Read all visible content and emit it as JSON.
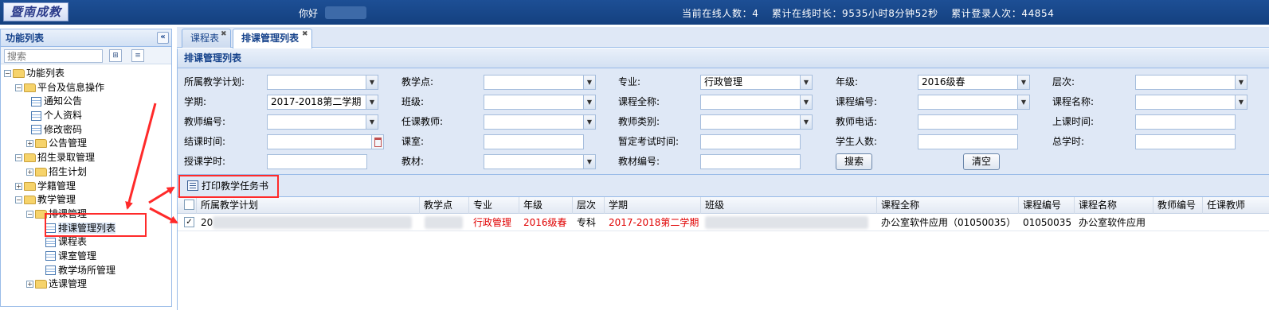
{
  "topbar": {
    "logo_text": "暨南成教",
    "greeting": "你好",
    "online_count_label": "当前在线人数：4",
    "online_time_label": "累计在线时长：9535小时8分钟52秒",
    "login_count_label": "累计登录人次：44854"
  },
  "left_panel": {
    "title": "功能列表",
    "search_placeholder": "搜索",
    "tree": [
      {
        "label": "功能列表",
        "toggle": "-",
        "icon": "folder-icon"
      },
      {
        "label": "平台及信息操作",
        "toggle": "-",
        "icon": "folder-icon"
      },
      {
        "label": "通知公告",
        "toggle": "",
        "icon": "grid-icon"
      },
      {
        "label": "个人资料",
        "toggle": "",
        "icon": "grid-icon"
      },
      {
        "label": "修改密码",
        "toggle": "",
        "icon": "grid-icon"
      },
      {
        "label": "公告管理",
        "toggle": "+",
        "icon": "folder-icon"
      },
      {
        "label": "招生录取管理",
        "toggle": "-",
        "icon": "folder-icon"
      },
      {
        "label": "招生计划",
        "toggle": "+",
        "icon": "folder-icon"
      },
      {
        "label": "学籍管理",
        "toggle": "+",
        "icon": "folder-icon"
      },
      {
        "label": "教学管理",
        "toggle": "-",
        "icon": "folder-icon"
      },
      {
        "label": "排课管理",
        "toggle": "-",
        "icon": "folder-icon"
      },
      {
        "label": "排课管理列表",
        "toggle": "",
        "icon": "grid-icon",
        "selected": true
      },
      {
        "label": "课程表",
        "toggle": "",
        "icon": "grid-icon"
      },
      {
        "label": "课室管理",
        "toggle": "",
        "icon": "grid-icon"
      },
      {
        "label": "教学场所管理",
        "toggle": "",
        "icon": "grid-icon"
      },
      {
        "label": "选课管理",
        "toggle": "+",
        "icon": "folder-icon"
      }
    ]
  },
  "tabs": [
    {
      "label": "课程表",
      "active": false
    },
    {
      "label": "排课管理列表",
      "active": true
    }
  ],
  "main": {
    "panel_title": "排课管理列表",
    "form": {
      "teaching_plan_label": "所属教学计划:",
      "teaching_point_label": "教学点:",
      "major_label": "专业:",
      "major_value": "行政管理",
      "grade_label": "年级:",
      "grade_value": "2016级春",
      "level_label": "层次:",
      "semester_label": "学期:",
      "semester_value": "2017-2018第二学期",
      "class_label": "班级:",
      "course_full_name_label": "课程全称:",
      "course_code_label": "课程编号:",
      "course_name_label": "课程名称:",
      "teacher_code_label": "教师编号:",
      "assigned_teacher_label": "任课教师:",
      "teacher_type_label": "教师类别:",
      "teacher_phone_label": "教师电话:",
      "class_time_label": "上课时间:",
      "end_time_label": "结课时间:",
      "classroom_label": "课室:",
      "tentative_exam_time_label": "暂定考试时间:",
      "student_count_label": "学生人数:",
      "total_hours_label": "总学时:",
      "teaching_hours_label": "授课学时:",
      "textbook_label": "教材:",
      "textbook_code_label": "教材编号:",
      "search_button": "搜索",
      "clear_button": "清空"
    },
    "toolbar": {
      "print_button": "打印教学任务书"
    },
    "grid": {
      "columns": [
        "所属教学计划",
        "教学点",
        "专业",
        "年级",
        "层次",
        "学期",
        "班级",
        "课程全称",
        "课程编号",
        "课程名称",
        "教师编号",
        "任课教师"
      ],
      "rows": [
        {
          "checked": true,
          "teaching_plan": "20",
          "major": "行政管理",
          "grade": "2016级春",
          "level": "专科",
          "semester": "2017-2018第二学期",
          "course_full_name": "办公室软件应用（01050035）",
          "course_code": "01050035",
          "course_name": "办公室软件应用"
        }
      ]
    }
  },
  "colors": {
    "topbar_bg": "#1d4f95",
    "panel_bg": "#dfe8f6",
    "border": "#99bbe8",
    "highlight_text": "#e00000",
    "annotation": "#ff2a2a"
  }
}
